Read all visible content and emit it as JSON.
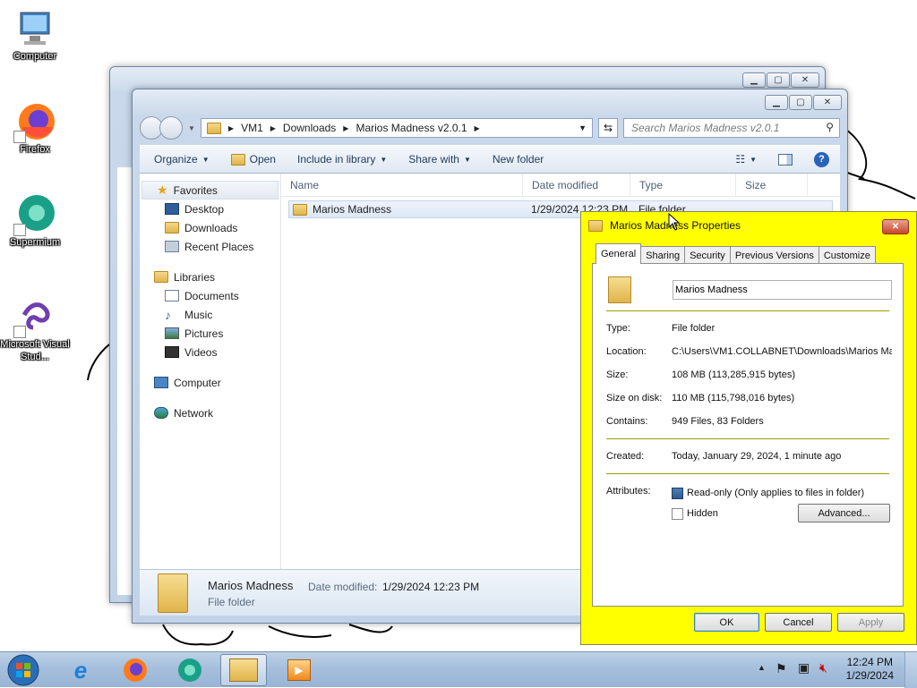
{
  "desktop": {
    "icons": [
      {
        "label": "Computer",
        "icon": "computer-icon"
      },
      {
        "label": "Firefox",
        "icon": "firefox-icon"
      },
      {
        "label": "Supermium",
        "icon": "supermium-icon"
      },
      {
        "label": "Microsoft Visual Stud...",
        "icon": "visual-studio-icon"
      }
    ]
  },
  "explorer": {
    "breadcrumb": [
      "VM1",
      "Downloads",
      "Marios Madness v2.0.1"
    ],
    "search_placeholder": "Search Marios Madness v2.0.1",
    "toolbar": {
      "organize": "Organize",
      "open": "Open",
      "include": "Include in library",
      "share": "Share with",
      "new_folder": "New folder"
    },
    "nav": {
      "favorites": "Favorites",
      "desktop": "Desktop",
      "downloads": "Downloads",
      "recent": "Recent Places",
      "libraries": "Libraries",
      "documents": "Documents",
      "music": "Music",
      "pictures": "Pictures",
      "videos": "Videos",
      "computer": "Computer",
      "network": "Network"
    },
    "columns": {
      "name": "Name",
      "date": "Date modified",
      "type": "Type",
      "size": "Size"
    },
    "rows": [
      {
        "name": "Marios Madness",
        "date": "1/29/2024 12:23 PM",
        "type": "File folder"
      }
    ],
    "details": {
      "name": "Marios Madness",
      "date_label": "Date modified:",
      "date_value": "1/29/2024 12:23 PM",
      "type": "File folder"
    }
  },
  "properties": {
    "title": "Marios Madness Properties",
    "tabs": [
      "General",
      "Sharing",
      "Security",
      "Previous Versions",
      "Customize"
    ],
    "name_value": "Marios Madness",
    "fields": {
      "type_k": "Type:",
      "type_v": "File folder",
      "loc_k": "Location:",
      "loc_v": "C:\\Users\\VM1.COLLABNET\\Downloads\\Marios Ma",
      "size_k": "Size:",
      "size_v": "108 MB (113,285,915 bytes)",
      "disk_k": "Size on disk:",
      "disk_v": "110 MB (115,798,016 bytes)",
      "contains_k": "Contains:",
      "contains_v": "949 Files, 83 Folders",
      "created_k": "Created:",
      "created_v": "Today, January 29, 2024, 1 minute ago",
      "attr_k": "Attributes:"
    },
    "readonly_label": "Read-only (Only applies to files in folder)",
    "hidden_label": "Hidden",
    "advanced_label": "Advanced...",
    "ok": "OK",
    "cancel": "Cancel",
    "apply": "Apply",
    "dialog_bg": "#ffff00"
  },
  "taskbar": {
    "time": "12:24 PM",
    "date": "1/29/2024"
  }
}
